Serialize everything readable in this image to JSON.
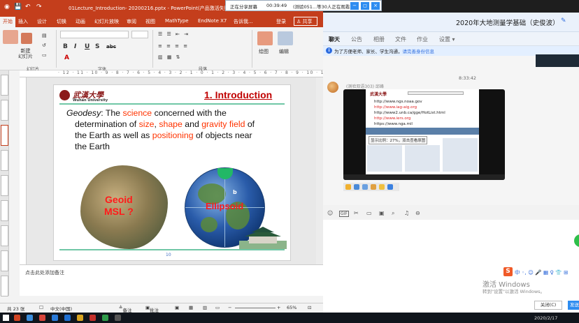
{
  "sharebar": {
    "status": "正在分享屏幕",
    "timer": "00:39:49",
    "viewers": "(测验051...等30人正在观看"
  },
  "ppt": {
    "doc_title": "01Lecture_Introduction- 20200216.pptx - PowerPoint(产品激活失败)",
    "tabs": [
      "开始",
      "插入",
      "设计",
      "切换",
      "动画",
      "幻灯片放映",
      "审阅",
      "视图",
      "MathType",
      "EndNote X7",
      "告诉我..."
    ],
    "login": "登录",
    "share": "共享",
    "ribbon": {
      "new_slide": "新建\n幻灯片",
      "slide_group": "幻灯片",
      "font_group": "字体",
      "para_group": "段落",
      "draw": "绘图",
      "edit": "编辑",
      "format_buttons": [
        "B",
        "I",
        "U",
        "S",
        "abc",
        "A"
      ]
    },
    "slide": {
      "logo_cn": "武漢大學",
      "logo_en": "Wuhan University",
      "title": "1. Introduction",
      "term": "Geodesy",
      "colon": ": The",
      "w_science": "science",
      "t1": "concerned with the",
      "t2": "determination of",
      "w_size": "size",
      "comma": ",",
      "w_shape": "shape",
      "and": "and",
      "w_gravity": "gravity field",
      "of": "of",
      "t3": "the Earth as well as",
      "w_positioning": "positioning",
      "t4": "of objects near",
      "t5": "the Earth",
      "geoid_label_1": "Geoid",
      "geoid_label_2": "MSL ?",
      "ellipsoid_label": "Ellipsoid",
      "globe_letter": "b",
      "page_number": "10"
    },
    "notes_placeholder": "点击此处添加备注",
    "status": {
      "slides": "共 23 张",
      "lang": "中文(中国)",
      "notes": "备注",
      "comments": "批注",
      "zoom": "65%"
    }
  },
  "chat": {
    "title": "2020年大地测量学基础（史俊波）",
    "tabs": [
      "聊天",
      "公告",
      "相册",
      "文件",
      "作业",
      "设置 ▾"
    ],
    "notice": "为了方便老师、家长、学生沟通，",
    "notice_link": "请完善身份信息",
    "time": "8:33:42",
    "sender": "(测验双语303) 邱峰",
    "shot": {
      "logo": "武漢大學",
      "links": [
        "http://www.ngs.noaa.gov",
        "http://www.iag-aig.org",
        "http://www2.unb.ca/gge/HotList.html",
        "http://www.iers.org",
        "https://www.nga.mil"
      ],
      "zoom_hint": "显示比例：27%，双击查看原图"
    },
    "toolbar_icons": [
      "smile-icon",
      "gif-icon",
      "scissors-icon",
      "folder-icon",
      "picture-icon",
      "bell-icon",
      "more-icon"
    ],
    "ime_chars": "中 ◦, ☺ 🎤 ▦ ♀ 👕 ⊞",
    "activate_1": "激活 Windows",
    "activate_2": "转到\"设置\"以激活 Windows。",
    "close_btn": "关闭(C)",
    "send_btn": "发送"
  },
  "taskbar": {
    "date": "2020/2/17"
  },
  "colors": {
    "ppt_red": "#c43e1c",
    "slide_title": "#c00000",
    "highlight": "#ff3300",
    "qq_blue": "#2d8cf0"
  }
}
